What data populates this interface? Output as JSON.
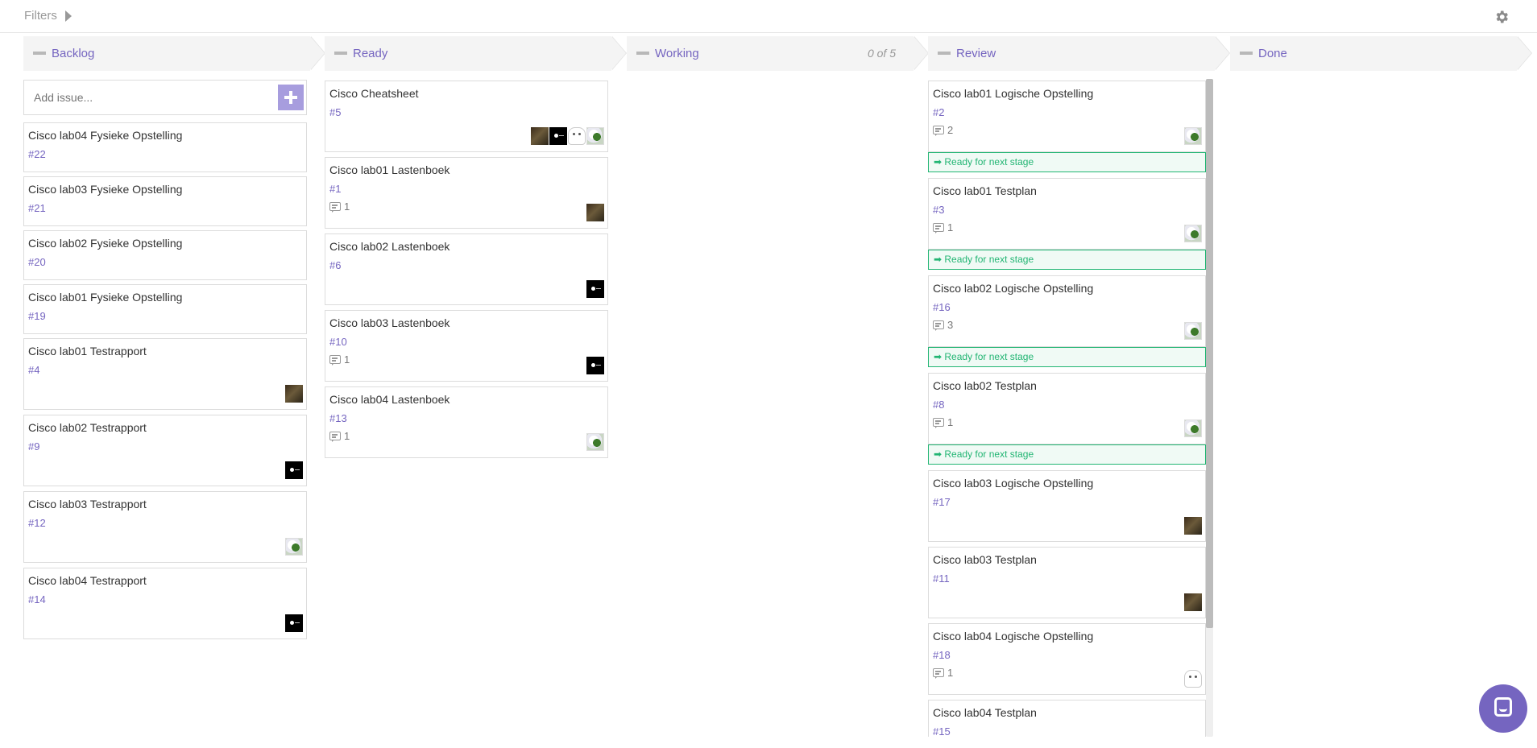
{
  "topbar": {
    "filters_label": "Filters",
    "settings_icon": "gear-icon"
  },
  "columns": {
    "backlog": {
      "title": "Backlog",
      "add_issue_placeholder": "Add issue...",
      "cards": [
        {
          "title": "Cisco lab04 Fysieke Opstelling",
          "number": "#22"
        },
        {
          "title": "Cisco lab03 Fysieke Opstelling",
          "number": "#21"
        },
        {
          "title": "Cisco lab02 Fysieke Opstelling",
          "number": "#20"
        },
        {
          "title": "Cisco lab01 Fysieke Opstelling",
          "number": "#19"
        },
        {
          "title": "Cisco lab01 Testrapport",
          "number": "#4",
          "avatars": [
            "dark"
          ]
        },
        {
          "title": "Cisco lab02 Testrapport",
          "number": "#9",
          "avatars": [
            "black"
          ]
        },
        {
          "title": "Cisco lab03 Testrapport",
          "number": "#12",
          "avatars": [
            "bird"
          ]
        },
        {
          "title": "Cisco lab04 Testrapport",
          "number": "#14",
          "avatars": [
            "black"
          ]
        }
      ]
    },
    "ready": {
      "title": "Ready",
      "cards": [
        {
          "title": "Cisco Cheatsheet",
          "number": "#5",
          "avatars": [
            "dark",
            "black",
            "ghost",
            "bird"
          ]
        },
        {
          "title": "Cisco lab01 Lastenboek",
          "number": "#1",
          "comments": "1",
          "avatars": [
            "dark"
          ]
        },
        {
          "title": "Cisco lab02 Lastenboek",
          "number": "#6",
          "avatars": [
            "black"
          ]
        },
        {
          "title": "Cisco lab03 Lastenboek",
          "number": "#10",
          "comments": "1",
          "avatars": [
            "black"
          ]
        },
        {
          "title": "Cisco lab04 Lastenboek",
          "number": "#13",
          "comments": "1",
          "avatars": [
            "bird"
          ]
        }
      ]
    },
    "working": {
      "title": "Working",
      "wip_limit": "0 of 5"
    },
    "review": {
      "title": "Review",
      "ready_label": "➡ Ready for next stage",
      "cards": [
        {
          "title": "Cisco lab01 Logische Opstelling",
          "number": "#2",
          "comments": "2",
          "avatars": [
            "bird"
          ],
          "ready_for_next": true
        },
        {
          "title": "Cisco lab01 Testplan",
          "number": "#3",
          "comments": "1",
          "avatars": [
            "bird"
          ],
          "ready_for_next": true
        },
        {
          "title": "Cisco lab02 Logische Opstelling",
          "number": "#16",
          "comments": "3",
          "avatars": [
            "bird"
          ],
          "ready_for_next": true
        },
        {
          "title": "Cisco lab02 Testplan",
          "number": "#8",
          "comments": "1",
          "avatars": [
            "bird"
          ],
          "ready_for_next": true
        },
        {
          "title": "Cisco lab03 Logische Opstelling",
          "number": "#17",
          "avatars": [
            "dark"
          ]
        },
        {
          "title": "Cisco lab03 Testplan",
          "number": "#11",
          "avatars": [
            "dark"
          ]
        },
        {
          "title": "Cisco lab04 Logische Opstelling",
          "number": "#18",
          "comments": "1",
          "avatars": [
            "ghost"
          ]
        },
        {
          "title": "Cisco lab04 Testplan",
          "number": "#15"
        }
      ]
    },
    "done": {
      "title": "Done"
    }
  },
  "colors": {
    "accent": "#7565c0",
    "ready_green": "#22b573",
    "header_bg": "#f4f4f4",
    "add_button": "#a79dde"
  },
  "chat_widget": {
    "icon": "chat-icon"
  }
}
